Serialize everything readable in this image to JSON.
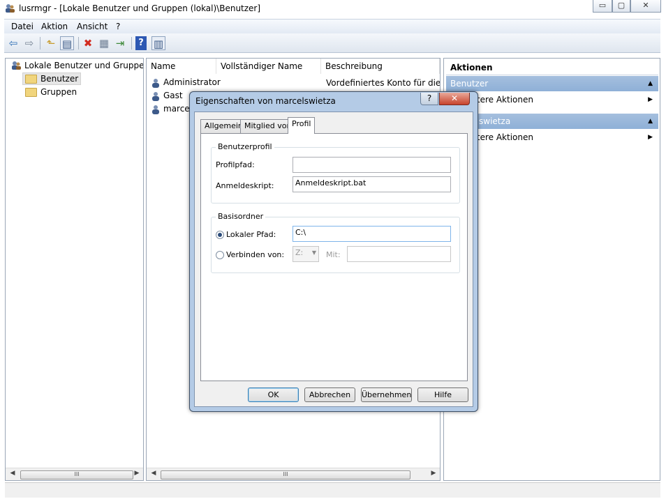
{
  "window": {
    "title": "lusrmgr - [Lokale Benutzer und Gruppen (lokal)\\Benutzer]",
    "minimize": "▭",
    "maximize": "▢",
    "close": "✕"
  },
  "menu": [
    "Datei",
    "Aktion",
    "Ansicht",
    "?"
  ],
  "toolbar": {
    "back": "⇦",
    "forward": "⇨",
    "up": "⬑",
    "show_tree": "▤",
    "delete": "✖",
    "properties": "▦",
    "export": "⇥",
    "help": "?",
    "show_actions": "▥"
  },
  "tree": {
    "root": "Lokale Benutzer und Gruppen (lokal)",
    "items": [
      "Benutzer",
      "Gruppen"
    ]
  },
  "list": {
    "columns": [
      "Name",
      "Vollständiger Name",
      "Beschreibung"
    ],
    "rows": [
      {
        "name": "Administrator",
        "fullname": "",
        "description": "Vordefiniertes Konto für die Verwaltung"
      },
      {
        "name": "Gast",
        "fullname": "",
        "description": ""
      },
      {
        "name": "marcelswietza",
        "fullname": "",
        "description": ""
      }
    ]
  },
  "actions": {
    "header": "Aktionen",
    "sections": [
      {
        "title": "Benutzer",
        "item": "Weitere Aktionen"
      },
      {
        "title": "marcelswietza",
        "item": "Weitere Aktionen"
      }
    ]
  },
  "scroll": {
    "left": "◀",
    "right": "▶",
    "thumb": "III"
  },
  "dialog": {
    "title": "Eigenschaften von marcelswietza",
    "help_btn": "?",
    "close_btn": "✕",
    "tabs": [
      "Allgemein",
      "Mitglied von",
      "Profil"
    ],
    "active_tab": "Profil",
    "profile_group": "Benutzerprofil",
    "profile_path_label": "Profilpfad:",
    "profile_path_value": "",
    "logon_script_label": "Anmeldeskript:",
    "logon_script_value": "Anmeldeskript.bat",
    "home_group": "Basisordner",
    "local_path_label": "Lokaler Pfad:",
    "local_path_value": "C:\\",
    "connect_label": "Verbinden von:",
    "drive_value": "Z:",
    "with_label": "Mit:",
    "with_value": "",
    "buttons": {
      "ok": "OK",
      "cancel": "Abbrechen",
      "apply": "Übernehmen",
      "help": "Hilfe"
    }
  }
}
